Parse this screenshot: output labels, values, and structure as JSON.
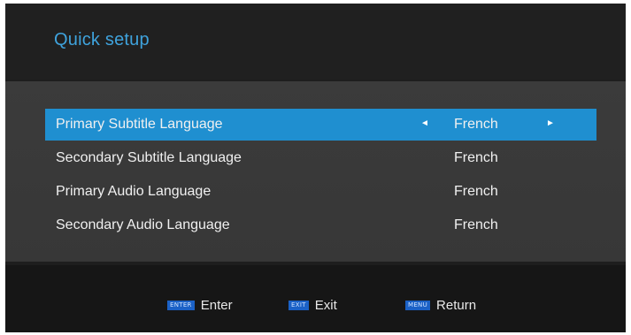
{
  "header": {
    "title": "Quick setup"
  },
  "rows": [
    {
      "label": "Primary Subtitle Language",
      "value": "French",
      "selected": true
    },
    {
      "label": "Secondary Subtitle Language",
      "value": "French"
    },
    {
      "label": "Primary Audio Language",
      "value": "French"
    },
    {
      "label": "Secondary Audio Language",
      "value": "French"
    }
  ],
  "footer": {
    "hints": [
      {
        "key": "ENTER",
        "label": "Enter"
      },
      {
        "key": "EXIT",
        "label": "Exit"
      },
      {
        "key": "MENU",
        "label": "Return"
      }
    ]
  },
  "colors": {
    "accent": "#3fa3dd",
    "selection": "#1f8fd0",
    "key_badge": "#1b61c6"
  },
  "icons": {
    "left_arrow": "left-arrow-icon",
    "right_arrow": "right-arrow-icon"
  }
}
